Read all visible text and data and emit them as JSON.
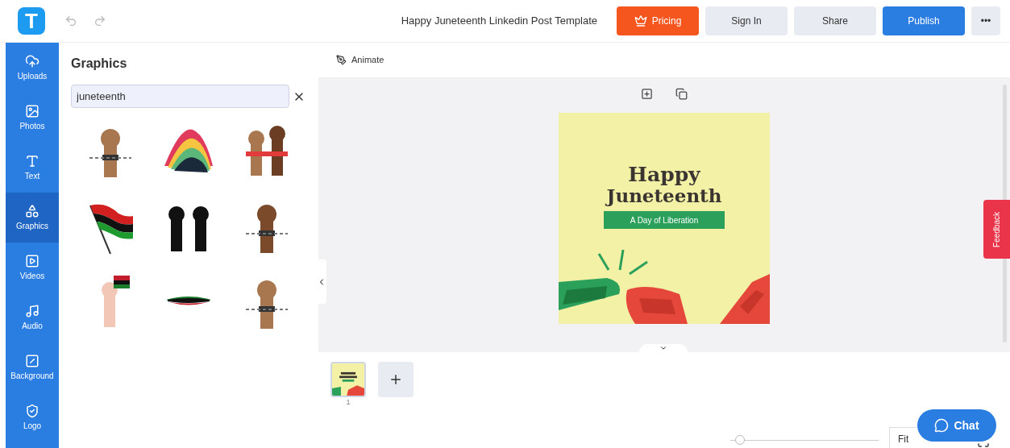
{
  "header": {
    "logo": "T",
    "title": "Happy Juneteenth Linkedin Post Template",
    "buttons": [
      {
        "label": "Pricing",
        "kind": "pricing"
      },
      {
        "label": "Sign In",
        "kind": "plain"
      },
      {
        "label": "Share",
        "kind": "plain"
      },
      {
        "label": "Publish",
        "kind": "primary"
      },
      {
        "label": "•••",
        "kind": "more"
      }
    ]
  },
  "sidebar": {
    "items": [
      {
        "label": "Uploads",
        "selected": false
      },
      {
        "label": "Photos",
        "selected": false
      },
      {
        "label": "Text",
        "selected": false
      },
      {
        "label": "Graphics",
        "selected": true
      },
      {
        "label": "Videos",
        "selected": false
      },
      {
        "label": "Audio",
        "selected": false
      },
      {
        "label": "Background",
        "selected": false
      },
      {
        "label": "Logo",
        "selected": false
      }
    ]
  },
  "panel": {
    "title": "Graphics",
    "search": {
      "value": "juneteenth"
    }
  },
  "toolbar": {
    "animate": "Animate"
  },
  "canvas": {
    "heading_1": "Happy",
    "heading_2": "Juneteenth",
    "ribbon": "A Day of Liberation"
  },
  "feedback": "Feedback",
  "pages": [
    {
      "number": "1",
      "selected": true
    }
  ],
  "zoom": {
    "level": 0.03,
    "fit": "Fit"
  },
  "chat": "Chat"
}
